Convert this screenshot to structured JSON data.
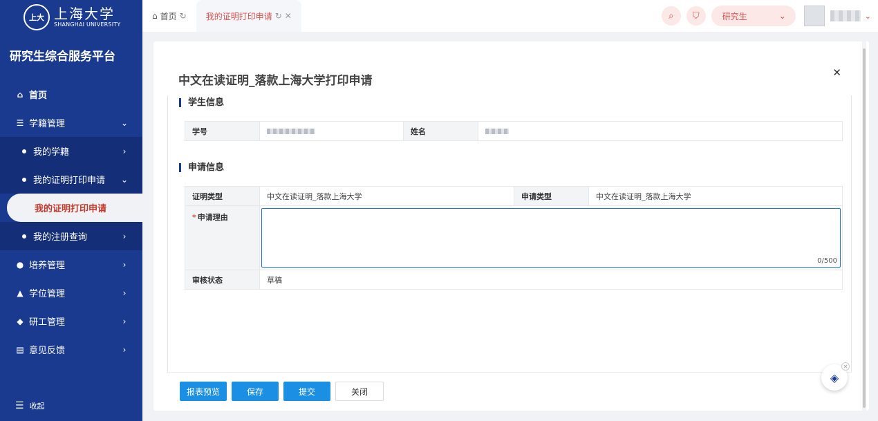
{
  "brand": {
    "seal_text": "上大",
    "name_cn": "上海大学",
    "name_en": "SHANGHAI UNIVERSITY",
    "platform": "研究生综合服务平台"
  },
  "sidebar": {
    "home": {
      "icon": "home-icon",
      "label": "首页"
    },
    "items": [
      {
        "icon": "student-record-icon",
        "label": "学籍管理",
        "chevron": "chevron-down-icon"
      },
      {
        "label": "我的学籍",
        "chevron": "chevron-right-icon"
      },
      {
        "label": "我的证明打印申请",
        "chevron": "chevron-down-icon"
      },
      {
        "label": "我的证明打印申请",
        "active": true
      },
      {
        "label": "我的注册查询",
        "chevron": "chevron-right-icon"
      },
      {
        "icon": "training-icon",
        "label": "培养管理",
        "chevron": "chevron-right-icon"
      },
      {
        "icon": "degree-icon",
        "label": "学位管理",
        "chevron": "chevron-right-icon"
      },
      {
        "icon": "shield-icon",
        "label": "研工管理",
        "chevron": "chevron-right-icon"
      },
      {
        "icon": "feedback-icon",
        "label": "意见反馈",
        "chevron": "chevron-right-icon"
      }
    ],
    "collapse_label": "收起"
  },
  "tabs": [
    {
      "label": "首页",
      "icon": "home-icon"
    },
    {
      "label": "我的证明打印申请",
      "current": true
    }
  ],
  "topbar": {
    "role": "研究生",
    "icons": [
      "search-icon",
      "shirt-icon"
    ]
  },
  "modal": {
    "title": "中文在读证明_落款上海大学打印申请",
    "student_section": "学生信息",
    "student": {
      "id_label": "学号",
      "name_label": "姓名"
    },
    "apply_section": "申请信息",
    "apply": {
      "cert_type_label": "证明类型",
      "cert_type_value": "中文在读证明_落款上海大学",
      "apply_type_label": "申请类型",
      "apply_type_value": "中文在读证明_落款上海大学",
      "reason_label": "申请理由",
      "reason_value": "",
      "reason_count": "0/500",
      "status_label": "审核状态",
      "status_value": "草稿"
    },
    "buttons": {
      "preview": "报表预览",
      "save": "保存",
      "submit": "提交",
      "close": "关闭"
    }
  },
  "colors": {
    "sidebar": "#1a3a8f",
    "accent_red": "#d9534f",
    "primary_button": "#1a8fe3"
  }
}
